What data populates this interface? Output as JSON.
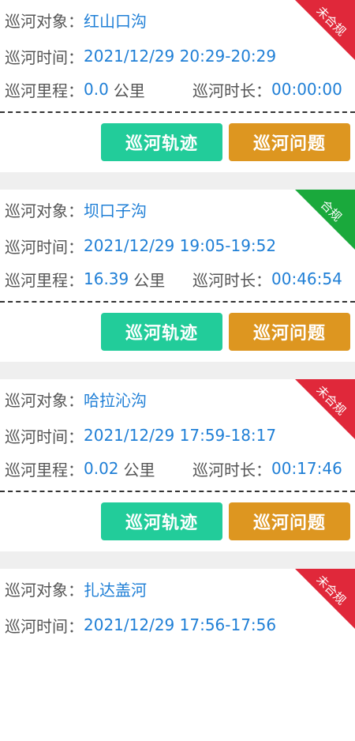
{
  "labels": {
    "target": "巡河对象：",
    "time": "巡河时间：",
    "distance": "巡河里程：",
    "duration": "巡河时长：",
    "unit_km": "公里",
    "btn_track": "巡河轨迹",
    "btn_problem": "巡河问题"
  },
  "colors": {
    "noncompliant": "#e0283a",
    "compliant": "#1aa93c",
    "track_button": "#22cc9a",
    "problem_button": "#dd9620",
    "value_text": "#1f7fd6"
  },
  "records": [
    {
      "target": "红山口沟",
      "time": "2021/12/29 20:29-20:29",
      "distance": "0.0",
      "duration": "00:00:00",
      "badge": "未合规",
      "compliant": false
    },
    {
      "target": "坝口子沟",
      "time": "2021/12/29 19:05-19:52",
      "distance": "16.39",
      "duration": "00:46:54",
      "badge": "合规",
      "compliant": true
    },
    {
      "target": "哈拉沁沟",
      "time": "2021/12/29 17:59-18:17",
      "distance": "0.02",
      "duration": "00:17:46",
      "badge": "未合规",
      "compliant": false
    },
    {
      "target": "扎达盖河",
      "time": "2021/12/29 17:56-17:56",
      "distance": "",
      "duration": "",
      "badge": "未合规",
      "compliant": false
    }
  ]
}
